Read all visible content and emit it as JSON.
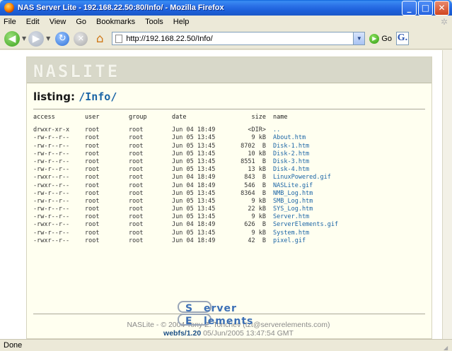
{
  "window": {
    "title": "NAS Server Lite - 192.168.22.50:80/Info/ - Mozilla Firefox",
    "controls": {
      "minimize": "_",
      "maximize": "□",
      "close": "✕"
    }
  },
  "menu": [
    "File",
    "Edit",
    "View",
    "Go",
    "Bookmarks",
    "Tools",
    "Help"
  ],
  "toolbar": {
    "url": "http://192.168.22.50/Info/",
    "go_label": "Go",
    "search_engine_glyph": "G."
  },
  "page": {
    "banner_logo": "NASLITE",
    "listing_label": "listing:",
    "listing_path": "/Info/",
    "columns": {
      "access": "access",
      "user": "user",
      "group": "group",
      "date": "date",
      "size": "size",
      "name": "name"
    },
    "rows": [
      {
        "access": "drwxr-xr-x",
        "user": "root",
        "group": "root",
        "date": "Jun 04 18:49",
        "size": "<DIR>",
        "name": ".."
      },
      {
        "access": "-rw-r--r--",
        "user": "root",
        "group": "root",
        "date": "Jun 05 13:45",
        "size": "9 kB",
        "name": "About.htm"
      },
      {
        "access": "-rw-r--r--",
        "user": "root",
        "group": "root",
        "date": "Jun 05 13:45",
        "size": "8702  B",
        "name": "Disk-1.htm"
      },
      {
        "access": "-rw-r--r--",
        "user": "root",
        "group": "root",
        "date": "Jun 05 13:45",
        "size": "10 kB",
        "name": "Disk-2.htm"
      },
      {
        "access": "-rw-r--r--",
        "user": "root",
        "group": "root",
        "date": "Jun 05 13:45",
        "size": "8551  B",
        "name": "Disk-3.htm"
      },
      {
        "access": "-rw-r--r--",
        "user": "root",
        "group": "root",
        "date": "Jun 05 13:45",
        "size": "13 kB",
        "name": "Disk-4.htm"
      },
      {
        "access": "-rwxr--r--",
        "user": "root",
        "group": "root",
        "date": "Jun 04 18:49",
        "size": "843  B",
        "name": "LinuxPowered.gif"
      },
      {
        "access": "-rwxr--r--",
        "user": "root",
        "group": "root",
        "date": "Jun 04 18:49",
        "size": "546  B",
        "name": "NASLite.gif"
      },
      {
        "access": "-rw-r--r--",
        "user": "root",
        "group": "root",
        "date": "Jun 05 13:45",
        "size": "8364  B",
        "name": "NMB_Log.htm"
      },
      {
        "access": "-rw-r--r--",
        "user": "root",
        "group": "root",
        "date": "Jun 05 13:45",
        "size": "9 kB",
        "name": "SMB_Log.htm"
      },
      {
        "access": "-rw-r--r--",
        "user": "root",
        "group": "root",
        "date": "Jun 05 13:45",
        "size": "22 kB",
        "name": "SYS_Log.htm"
      },
      {
        "access": "-rw-r--r--",
        "user": "root",
        "group": "root",
        "date": "Jun 05 13:45",
        "size": "9 kB",
        "name": "Server.htm"
      },
      {
        "access": "-rwxr--r--",
        "user": "root",
        "group": "root",
        "date": "Jun 04 18:49",
        "size": "626  B",
        "name": "ServerElements.gif"
      },
      {
        "access": "-rw-r--r--",
        "user": "root",
        "group": "root",
        "date": "Jun 05 13:45",
        "size": "9 kB",
        "name": "System.htm"
      },
      {
        "access": "-rwxr--r--",
        "user": "root",
        "group": "root",
        "date": "Jun 04 18:49",
        "size": "42  B",
        "name": "pixel.gif"
      }
    ],
    "footer_credit": "NASLite - © 2004 Tony Z. Tonchev (tzt@serverelements.com)",
    "footer_version": "webfs/1.20",
    "footer_date": "05/Jun/2005 13:47:54 GMT",
    "server_elements_logo": "Server Elements"
  },
  "status": {
    "text": "Done"
  },
  "colors": {
    "link": "#1b65a6",
    "panel_bg": "#fffff0",
    "banner_bg": "#d8d8c9",
    "xp_blue": "#2a6fe6"
  }
}
